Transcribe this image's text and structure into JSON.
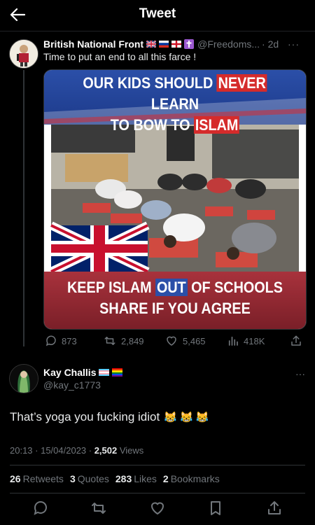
{
  "header": {
    "title": "Tweet"
  },
  "tweet": {
    "author_name": "British National Front",
    "handle": "@Freedoms...",
    "time": "· 2d",
    "text": "Time to put an end to all this farce !",
    "media": {
      "banner_top_line1_a": "OUR KIDS SHOULD ",
      "banner_top_line1_b": "NEVER",
      "banner_top_line1_c": " LEARN",
      "banner_top_line2_a": "TO BOW TO ",
      "banner_top_line2_b": "ISLAM",
      "banner_bottom_line1_a": "KEEP ISLAM ",
      "banner_bottom_line1_b": "OUT",
      "banner_bottom_line1_c": " OF SCHOOLS",
      "banner_bottom_line2": "SHARE IF YOU AGREE"
    },
    "actions": {
      "replies": "873",
      "retweets": "2,849",
      "likes": "5,465",
      "views": "418K"
    }
  },
  "reply": {
    "author_name": "Kay Challis",
    "handle": "@kay_c1773",
    "text": "That’s yoga you fucking idiot",
    "emoji": "😹 😹 😹",
    "meta_time": "20:13 · 15/04/2023 · ",
    "meta_views_count": "2,502",
    "meta_views_label": " Views",
    "stats": {
      "retweets_count": "26",
      "retweets_label": "Retweets",
      "quotes_count": "3",
      "quotes_label": "Quotes",
      "likes_count": "283",
      "likes_label": "Likes",
      "bookmarks_count": "2",
      "bookmarks_label": "Bookmarks"
    }
  },
  "colors": {
    "background": "#000000",
    "muted": "#71767b",
    "text": "#e7e9ea",
    "divider": "#2f3336"
  }
}
